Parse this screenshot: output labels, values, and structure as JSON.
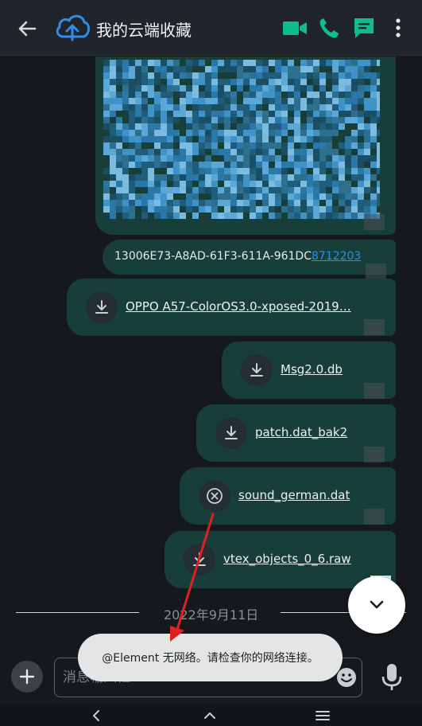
{
  "header": {
    "title": "我的云端收藏",
    "icons": {
      "back": "arrow-left-icon",
      "avatar": "cloud-upload-icon",
      "video": "video-camera-icon",
      "call": "phone-icon",
      "threads": "threads-chat-icon",
      "more": "more-vertical-icon"
    }
  },
  "timeline": {
    "text_message": {
      "prefix": "13006E73-A8AD-61F3-611A-961DC",
      "link": "8712203"
    },
    "files": [
      {
        "name": "OPPO A57-ColorOS3.0-xposed-2019…",
        "status": "download"
      },
      {
        "name": "Msg2.0.db",
        "status": "download"
      },
      {
        "name": "patch.dat_bak2",
        "status": "download"
      },
      {
        "name": "sound_german.dat",
        "status": "cancel"
      },
      {
        "name": "vtex_objects_0_6.raw",
        "status": "download"
      }
    ],
    "date_separator": "2022年9月11日"
  },
  "composer": {
    "placeholder": "消息输入框"
  },
  "toast": {
    "message": "@Element 无网络。请检查你的网络连接。"
  },
  "colors": {
    "accent": "#0dbd8b",
    "bubble": "#173e38",
    "link": "#2f8fe0",
    "annotation_arrow": "#e02020"
  }
}
